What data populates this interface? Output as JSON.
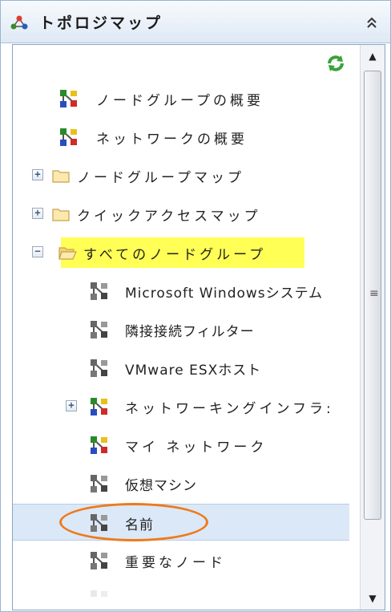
{
  "header": {
    "title": "トポロジマップ",
    "collapse_glyph": "⌃⌃",
    "icon": "topology-icon"
  },
  "toolbar": {
    "refresh_icon": "refresh-icon"
  },
  "tree": {
    "items": [
      {
        "label": "ノードグループの概要",
        "icon": "color-nodes-icon",
        "expander": "",
        "indent": 0
      },
      {
        "label": "ネットワークの概要",
        "icon": "color-nodes-icon",
        "expander": "",
        "indent": 0
      },
      {
        "label": "ノードグループマップ",
        "icon": "folder-icon",
        "expander": "+",
        "indent": 0
      },
      {
        "label": "クイックアクセスマップ",
        "icon": "folder-icon",
        "expander": "+",
        "indent": 0
      },
      {
        "label": "すべてのノードグループ",
        "icon": "folder-open-icon",
        "expander": "−",
        "indent": 0,
        "highlighted": true
      },
      {
        "label": "Microsoft Windowsシステム",
        "icon": "gray-nodes-icon",
        "expander": "",
        "indent": 1
      },
      {
        "label": "隣接接続フィルター",
        "icon": "gray-nodes-icon",
        "expander": "",
        "indent": 1
      },
      {
        "label": "VMware ESXホスト",
        "icon": "gray-nodes-icon",
        "expander": "",
        "indent": 1
      },
      {
        "label": "ネットワーキングインフラ:",
        "icon": "color-nodes-icon",
        "expander": "+",
        "indent": 1
      },
      {
        "label": "マイ ネットワーク",
        "icon": "color-nodes-icon",
        "expander": "",
        "indent": 1
      },
      {
        "label": "仮想マシン",
        "icon": "gray-nodes-icon",
        "expander": "",
        "indent": 1
      },
      {
        "label": "名前",
        "icon": "gray-nodes-icon",
        "expander": "",
        "indent": 1,
        "selected": true,
        "circled": true
      },
      {
        "label": "重要なノード",
        "icon": "gray-nodes-icon",
        "expander": "",
        "indent": 1
      }
    ]
  },
  "scrollbar": {
    "up_glyph": "▲",
    "down_glyph": "▼",
    "grip_glyph": "≡"
  },
  "colors": {
    "highlight": "#ffff55",
    "circle": "#ee7a1a",
    "selection": "#dbe8f7",
    "header_border": "#99b4d1"
  }
}
